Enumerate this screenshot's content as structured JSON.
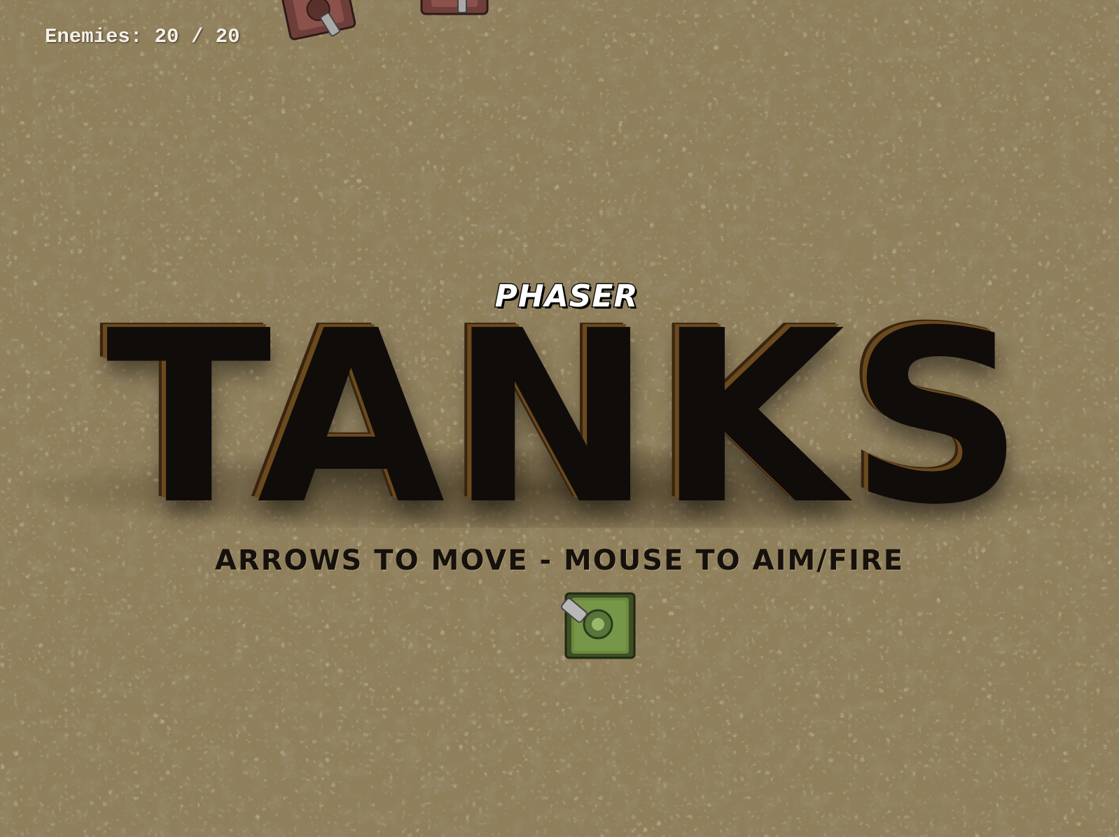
{
  "hud": {
    "enemies_label": "Enemies:",
    "enemies_alive": "20",
    "enemies_separator": "/",
    "enemies_total": "20"
  },
  "title": {
    "logo_text": "PHASER",
    "main_title": "TANKS",
    "instructions": "ARROWS TO MOVE - MOUSE TO AIM/FIRE"
  },
  "sprites": {
    "player_tank": "player-tank-icon",
    "enemy_tank": "enemy-tank-icon"
  },
  "colors": {
    "ground": "#8f7f5b",
    "player_tank": "#5f7a3a",
    "enemy_tank": "#7a4a44",
    "title_face": "#100c0a",
    "title_edge": "#6b4a1d",
    "hud_text": "#f4f1e8"
  }
}
